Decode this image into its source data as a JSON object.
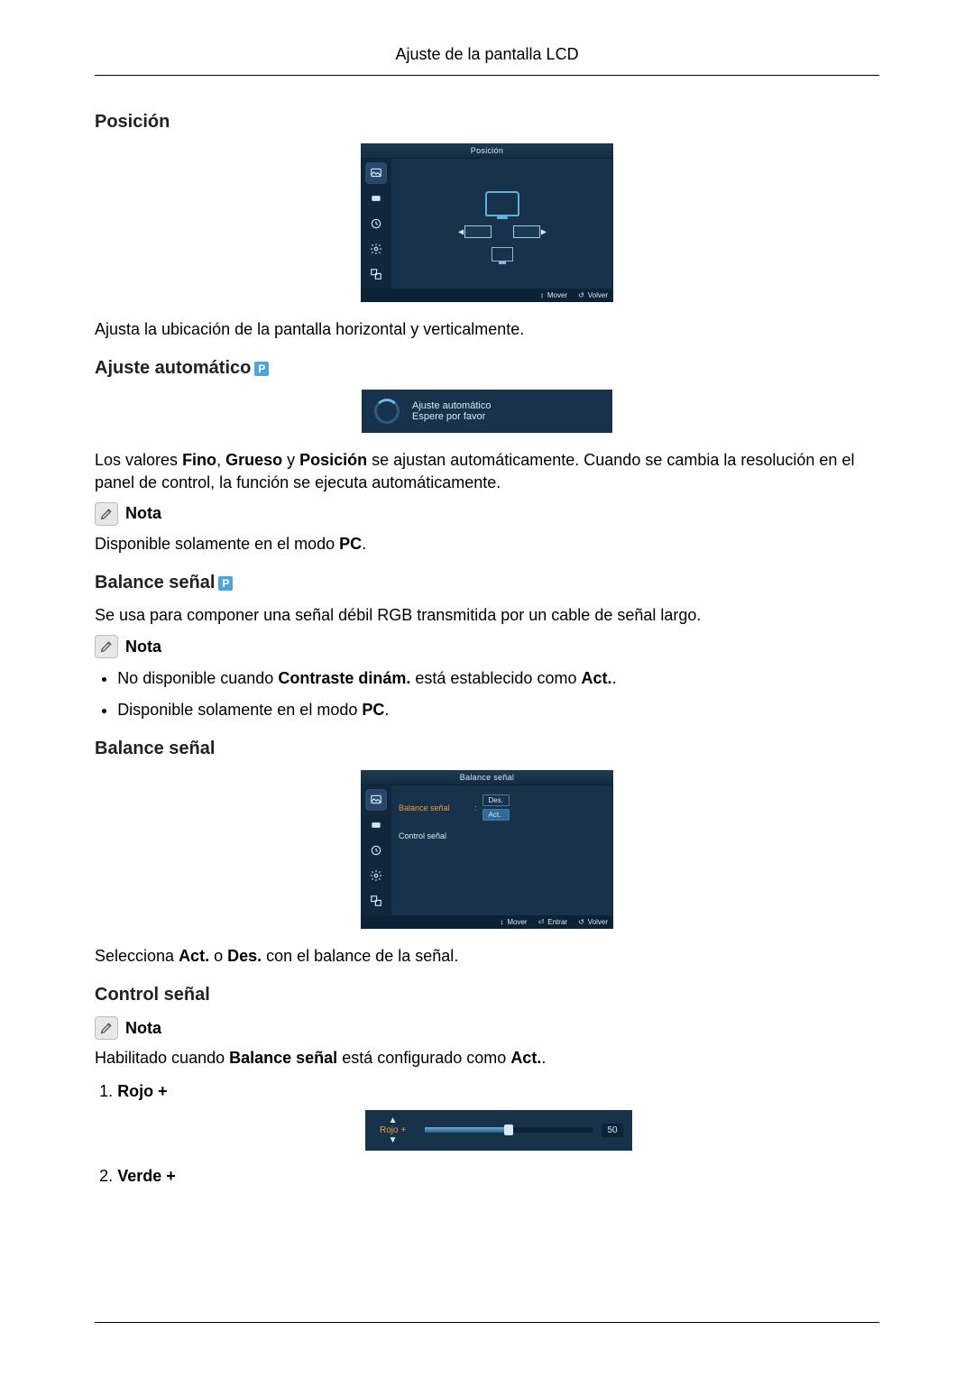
{
  "header": {
    "title": "Ajuste de la pantalla LCD"
  },
  "sections": {
    "posicion": {
      "heading": "Posición",
      "osd_title": "Posición",
      "footer_move": "Mover",
      "footer_return": "Volver",
      "desc": "Ajusta la ubicación de la pantalla horizontal y verticalmente."
    },
    "auto": {
      "heading": "Ajuste automático",
      "p_badge": "P",
      "msg1": "Ajuste automático",
      "msg2": "Espere por favor",
      "desc_pre": "Los valores ",
      "bold1": "Fino",
      "bold2": "Grueso",
      "bold3": "Posición",
      "desc_mid": " se ajustan automáticamente. Cuando se cambia la resolución en el panel de control, la función se ejecuta automáticamente.",
      "note_label": "Nota",
      "note_text_pre": "Disponible solamente en el modo ",
      "note_bold": "PC",
      "note_text_post": "."
    },
    "balance_head": {
      "heading": "Balance señal",
      "p_badge": "P",
      "desc": "Se usa para componer una señal débil RGB transmitida por un cable de señal largo.",
      "note_label": "Nota",
      "bullet1_pre": "No disponible cuando ",
      "bullet1_bold": "Contraste dinám.",
      "bullet1_mid": " está establecido como ",
      "bullet1_bold2": "Act.",
      "bullet1_post": ".",
      "bullet2_pre": "Disponible solamente en el modo ",
      "bullet2_bold": "PC",
      "bullet2_post": "."
    },
    "balance_sub": {
      "heading": "Balance señal",
      "osd_title": "Balance señal",
      "row1_label": "Balance señal",
      "row2_label": "Control señal",
      "val_off": "Des.",
      "val_on": "Act.",
      "footer_move": "Mover",
      "footer_enter": "Entrar",
      "footer_return": "Volver",
      "desc_pre": "Selecciona ",
      "desc_b1": "Act.",
      "desc_mid": " o ",
      "desc_b2": "Des.",
      "desc_post": " con el balance de la señal."
    },
    "control": {
      "heading": "Control señal",
      "note_label": "Nota",
      "desc_pre": "Habilitado cuando ",
      "desc_bold1": "Balance señal",
      "desc_mid": " está configurado como ",
      "desc_bold2": "Act.",
      "desc_post": ".",
      "item1": "Rojo +",
      "item2": "Verde +",
      "slider_label": "Rojo +",
      "slider_value": "50"
    }
  }
}
